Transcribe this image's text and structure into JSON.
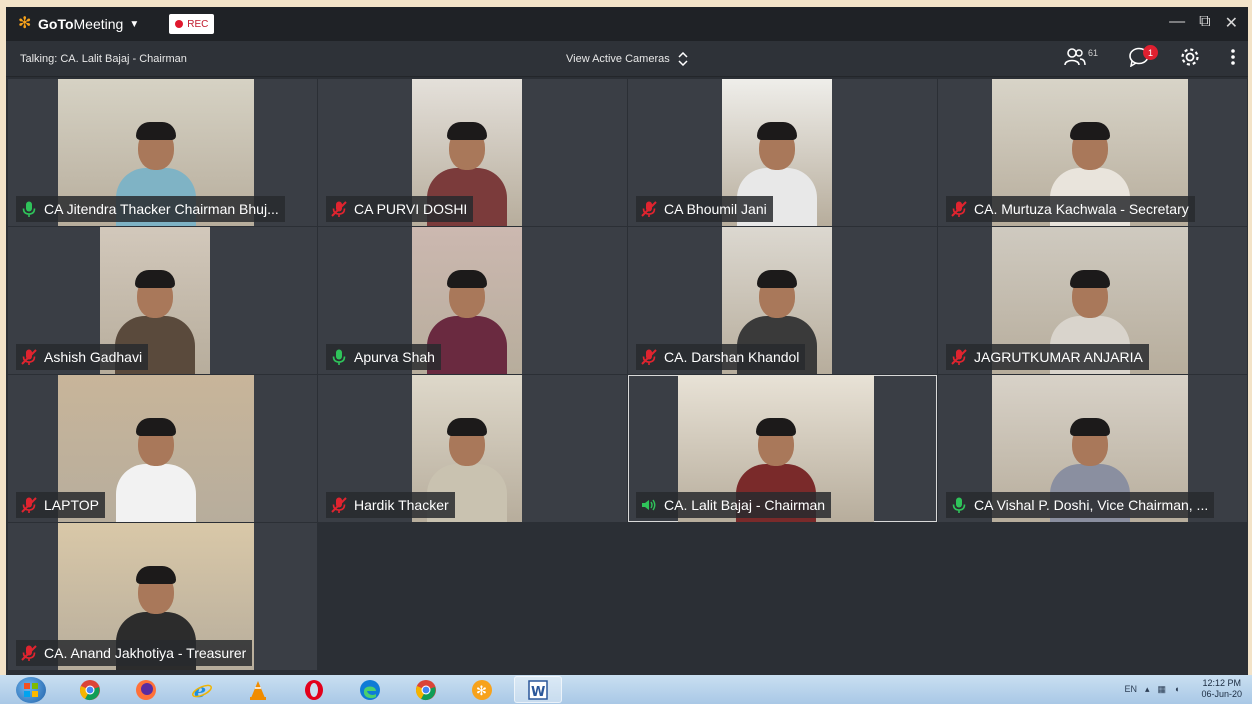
{
  "app": {
    "name_bold": "GoTo",
    "name_rest": "Meeting",
    "rec_label": "REC"
  },
  "infobar": {
    "talking": "Talking: CA. Lalit Bajaj - Chairman",
    "view_cameras": "View Active Cameras",
    "attendee_count": "61",
    "chat_badge": "1"
  },
  "participants": [
    {
      "name": "CA Jitendra Thacker Chairman Bhuj...",
      "mic": "on"
    },
    {
      "name": "CA PURVI DOSHI",
      "mic": "muted"
    },
    {
      "name": "CA Bhoumil Jani",
      "mic": "muted"
    },
    {
      "name": "CA. Murtuza Kachwala - Secretary",
      "mic": "muted"
    },
    {
      "name": "Ashish Gadhavi",
      "mic": "muted"
    },
    {
      "name": "Apurva Shah",
      "mic": "on"
    },
    {
      "name": "CA. Darshan Khandol",
      "mic": "muted"
    },
    {
      "name": "JAGRUTKUMAR ANJARIA",
      "mic": "muted"
    },
    {
      "name": "LAPTOP",
      "mic": "muted"
    },
    {
      "name": "Hardik Thacker",
      "mic": "muted"
    },
    {
      "name": "CA. Lalit Bajaj - Chairman",
      "mic": "speaking"
    },
    {
      "name": "CA Vishal P. Doshi, Vice Chairman, ...",
      "mic": "on"
    },
    {
      "name": "CA. Anand Jakhotiya - Treasurer",
      "mic": "muted"
    }
  ],
  "taskbar": {
    "apps": [
      "chrome",
      "firefox",
      "internet-explorer",
      "vlc",
      "opera",
      "edge",
      "chrome",
      "gotomeeting",
      "word"
    ],
    "tray_text": "EN",
    "clock_time": "12:12 PM",
    "clock_date": "06-Jun-20"
  },
  "colors": {
    "mic_muted": "#e0242f",
    "mic_on": "#2fc35a",
    "accent": "#f7a21b"
  }
}
